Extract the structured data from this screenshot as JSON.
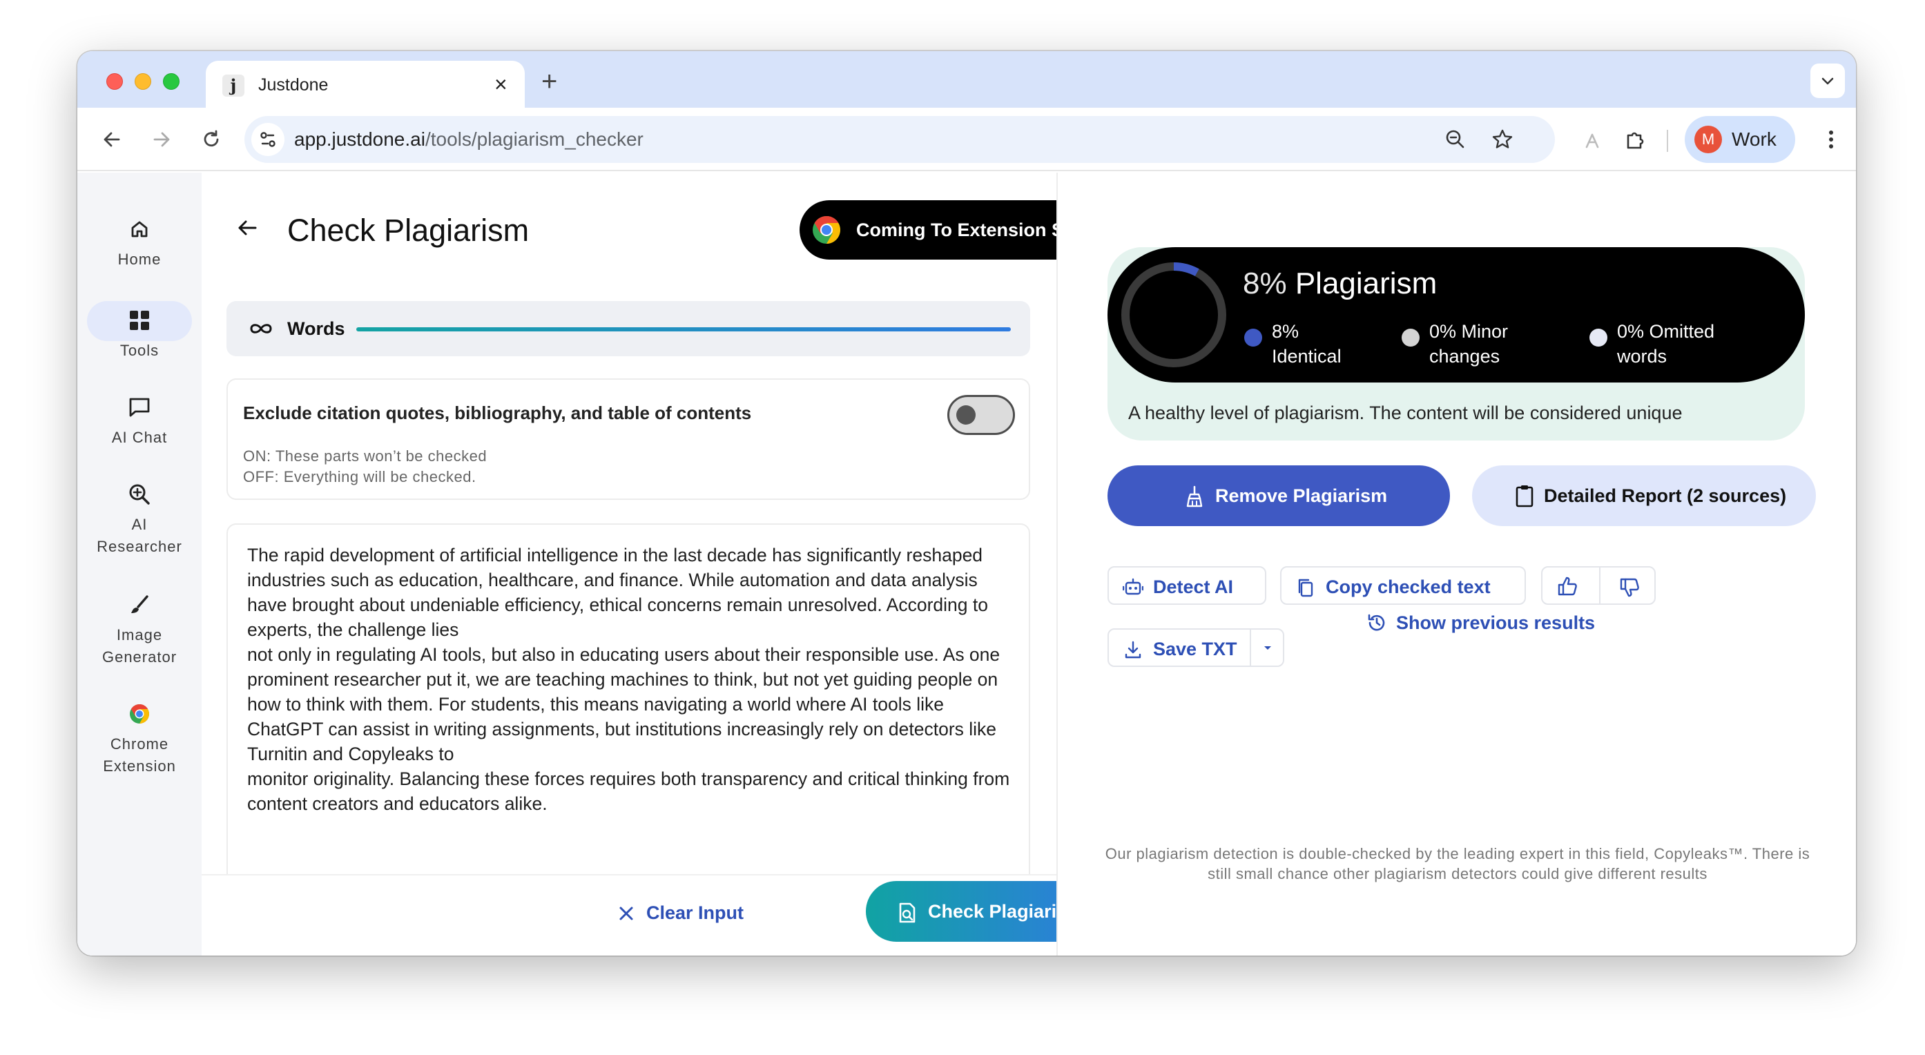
{
  "browser": {
    "tab_title": "Justdone",
    "tab_favicon": "j",
    "url_host": "app.justdone.ai",
    "url_path": "/tools/plagiarism_checker",
    "profile_initial": "M",
    "profile_label": "Work"
  },
  "sidebar": {
    "items": [
      {
        "label": "Home",
        "icon": "home-icon"
      },
      {
        "label": "Tools",
        "icon": "grid-icon"
      },
      {
        "label": "AI Chat",
        "icon": "chat-icon"
      },
      {
        "label_line1": "AI",
        "label_line2": "Researcher",
        "icon": "search-plus-icon"
      },
      {
        "label_line1": "Image",
        "label_line2": "Generator",
        "icon": "brush-icon"
      },
      {
        "label_line1": "Chrome",
        "label_line2": "Extension",
        "icon": "chrome-icon"
      }
    ]
  },
  "main": {
    "title": "Check Plagiarism",
    "extension_button": "Coming To Extension Soon",
    "words_label": "Words",
    "exclude": {
      "title": "Exclude citation quotes, bibliography, and table of contents",
      "on_text": "ON: These parts won’t be checked",
      "off_text": "OFF: Everything will be checked.",
      "enabled": false
    },
    "input_text": {
      "p1": "The rapid development of artificial intelligence in the last decade has significantly reshaped industries such as education, healthcare, and finance. While automation and data analysis have brought about undeniable efficiency, ethical concerns remain unresolved. According to experts, the challenge lies",
      "p2": "not only in regulating AI tools, but also in educating users about their responsible use. As one prominent researcher put it, we are teaching machines to think, but not yet guiding people on how to think with them. For students, this means navigating a world where AI tools like ChatGPT can assist in writing assignments, but institutions increasingly rely on detectors like Turnitin and Copyleaks to",
      "p3": "monitor originality. Balancing these forces requires both transparency and critical thinking from content creators and educators alike."
    },
    "clear_button": "Clear Input",
    "check_button": "Check Plagiarism"
  },
  "results": {
    "plagiarism_percent": "8%",
    "plagiarism_label": "Plagiarism",
    "plagiarism_fraction": 0.08,
    "stats": [
      {
        "line1": "8%",
        "line2": "Identical",
        "color": "#3f59c3"
      },
      {
        "line1": "0% Minor",
        "line2": "changes",
        "color": "#d4d4d4"
      },
      {
        "line1": "0% Omitted",
        "line2": "words",
        "color": "#e6e9f5"
      }
    ],
    "summary": "A healthy level of plagiarism. The content will be considered unique",
    "remove_button": "Remove Plagiarism",
    "report_button": "Detailed Report (2 sources)",
    "detect_ai": "Detect AI",
    "copy_checked": "Copy checked text",
    "save_txt": "Save TXT",
    "previous_results": "Show previous results",
    "footnote": "Our plagiarism detection is double-checked by the leading expert in this field, Copyleaks™. There is still small chance other plagiarism detectors could give different results"
  },
  "colors": {
    "accent_blue": "#3f59c3",
    "link_blue": "#2d4fb5",
    "teal_gradient_start": "#11a3a3",
    "teal_gradient_end": "#2f7be0"
  }
}
